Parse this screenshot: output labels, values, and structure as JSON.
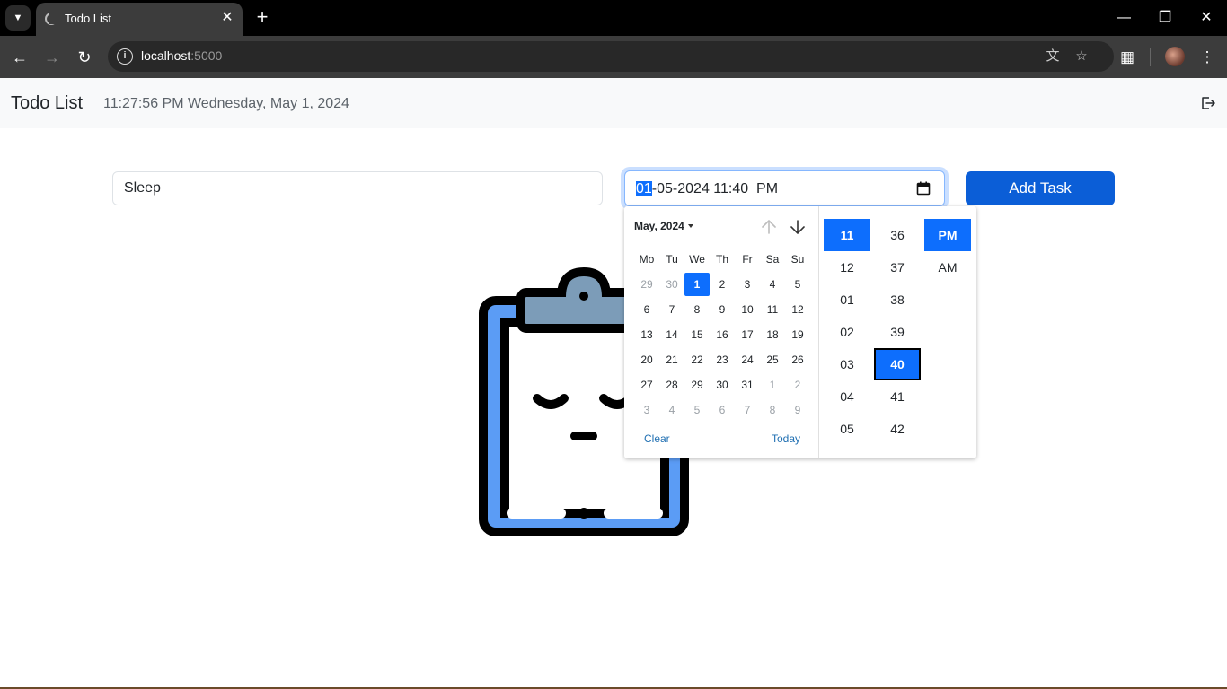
{
  "browser": {
    "tab_title": "Todo List",
    "url_host": "localhost",
    "url_port": ":5000"
  },
  "app": {
    "brand": "Todo List",
    "clock": "11:27:56 PM Wednesday, May 1, 2024"
  },
  "form": {
    "task_value": "Sleep",
    "date_day": "01",
    "date_rest": "-05-2024 11:40  PM",
    "add_label": "Add Task"
  },
  "picker": {
    "month_label": "May, 2024",
    "weekdays": [
      "Mo",
      "Tu",
      "We",
      "Th",
      "Fr",
      "Sa",
      "Su"
    ],
    "weeks": [
      [
        "29",
        "30",
        "1",
        "2",
        "3",
        "4",
        "5"
      ],
      [
        "6",
        "7",
        "8",
        "9",
        "10",
        "11",
        "12"
      ],
      [
        "13",
        "14",
        "15",
        "16",
        "17",
        "18",
        "19"
      ],
      [
        "20",
        "21",
        "22",
        "23",
        "24",
        "25",
        "26"
      ],
      [
        "27",
        "28",
        "29",
        "30",
        "31",
        "1",
        "2"
      ],
      [
        "3",
        "4",
        "5",
        "6",
        "7",
        "8",
        "9"
      ]
    ],
    "clear_label": "Clear",
    "today_label": "Today",
    "hours": [
      "11",
      "12",
      "01",
      "02",
      "03",
      "04",
      "05"
    ],
    "minutes": [
      "36",
      "37",
      "38",
      "39",
      "40",
      "41",
      "42"
    ],
    "meridiem": [
      "PM",
      "AM"
    ]
  },
  "colors": {
    "accent": "#0d6efd",
    "button": "#0b5ed7",
    "clipboard_fill": "#5b9cf5",
    "clip_fill": "#7c9cb8"
  }
}
